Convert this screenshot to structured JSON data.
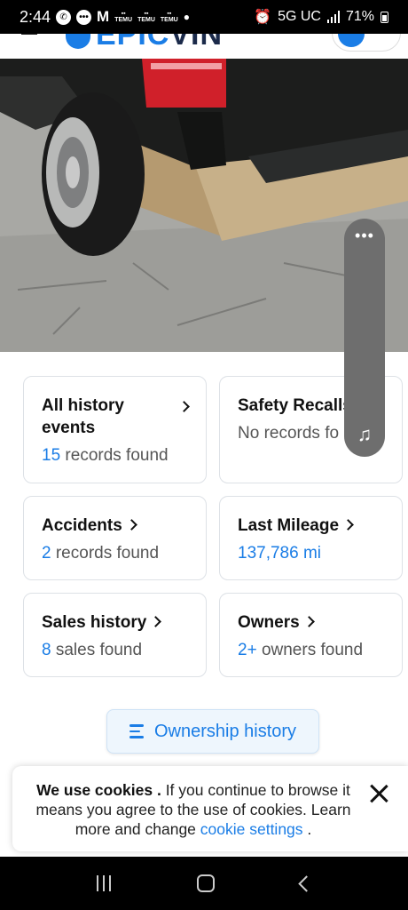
{
  "status_bar": {
    "time": "2:44",
    "temu_label": "TEMU",
    "network": "5G UC",
    "battery": "71%"
  },
  "header": {
    "logo_text_a": "EPIC",
    "logo_text_b": "VIN"
  },
  "cards": {
    "all_history": {
      "title": "All history events",
      "count": "15",
      "sub": "records found"
    },
    "safety_recalls": {
      "title": "Safety Recalls",
      "sub": "No records fo"
    },
    "accidents": {
      "title": "Accidents",
      "count": "2",
      "sub": "records found"
    },
    "last_mileage": {
      "title": "Last Mileage",
      "value": "137,786 mi"
    },
    "sales_history": {
      "title": "Sales history",
      "count": "8",
      "sub": "sales found"
    },
    "owners": {
      "title": "Owners",
      "count": "2+",
      "sub": "owners found"
    }
  },
  "ownership_button": {
    "label": "Ownership history"
  },
  "cookie": {
    "bold": "We use cookies .",
    "text": " If you continue to browse it means you agree to the use of cookies. Learn more and change ",
    "link": "cookie settings",
    "end": " ."
  },
  "colors": {
    "accent": "#1a7de6",
    "text": "#111111",
    "muted": "#555555"
  }
}
